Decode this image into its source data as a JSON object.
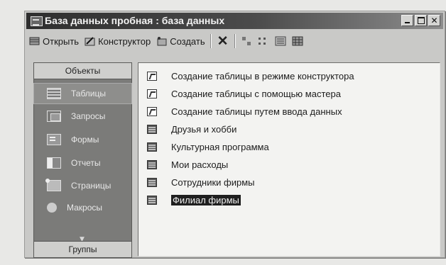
{
  "window": {
    "title": "База данных пробная : база данных",
    "controls": [
      "minimize-icon",
      "maximize-icon",
      "close-icon"
    ]
  },
  "toolbar": {
    "open_label": "Открыть",
    "design_label": "Конструктор",
    "create_label": "Создать",
    "delete_icon": "delete-icon",
    "view_icons": [
      "large-icons-icon",
      "small-icons-icon",
      "list-icon",
      "details-icon"
    ]
  },
  "nav": {
    "objects_label": "Объекты",
    "groups_label": "Группы",
    "items": [
      {
        "label": "Таблицы",
        "icon": "table-icon",
        "selected": true
      },
      {
        "label": "Запросы",
        "icon": "query-icon",
        "selected": false
      },
      {
        "label": "Формы",
        "icon": "form-icon",
        "selected": false
      },
      {
        "label": "Отчеты",
        "icon": "report-icon",
        "selected": false
      },
      {
        "label": "Страницы",
        "icon": "page-icon",
        "selected": false
      },
      {
        "label": "Макросы",
        "icon": "macro-icon",
        "selected": false
      }
    ]
  },
  "list": {
    "items": [
      {
        "label": "Создание таблицы в режиме конструктора",
        "icon": "wizard-icon",
        "selected": false
      },
      {
        "label": "Создание таблицы с помощью мастера",
        "icon": "wizard-icon",
        "selected": false
      },
      {
        "label": "Создание таблицы путем ввода данных",
        "icon": "wizard-icon",
        "selected": false
      },
      {
        "label": "Друзья и хобби",
        "icon": "table-icon",
        "selected": false
      },
      {
        "label": "Культурная программа",
        "icon": "table-icon",
        "selected": false
      },
      {
        "label": "Мои расходы",
        "icon": "table-icon",
        "selected": false
      },
      {
        "label": "Сотрудники фирмы",
        "icon": "table-icon",
        "selected": false
      },
      {
        "label": "Филиал фирмы",
        "icon": "table-icon",
        "selected": true
      }
    ]
  }
}
